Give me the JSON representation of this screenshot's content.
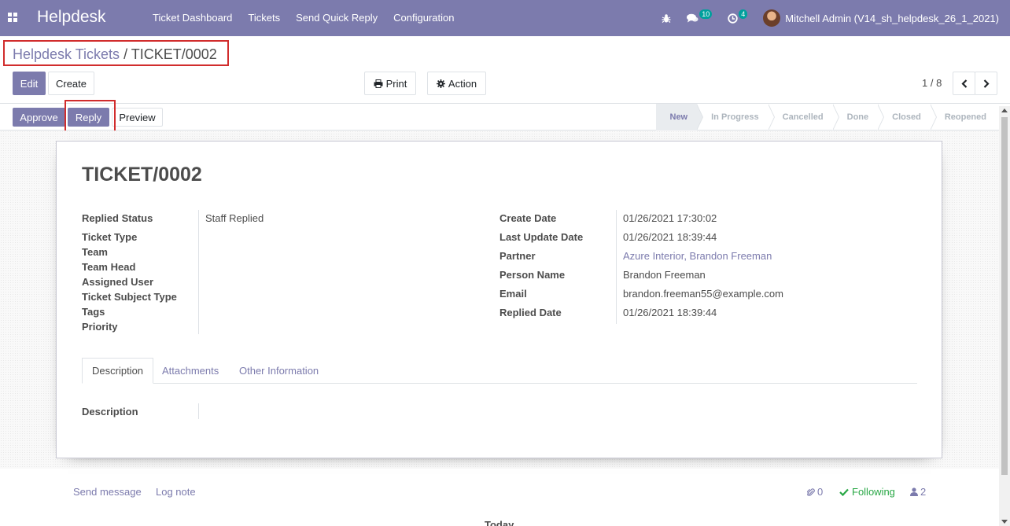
{
  "navbar": {
    "brand": "Helpdesk",
    "menu": [
      "Ticket Dashboard",
      "Tickets",
      "Send Quick Reply",
      "Configuration"
    ],
    "messages_count": "10",
    "activities_count": "4",
    "user": "Mitchell Admin (V14_sh_helpdesk_26_1_2021)",
    "color": "#7c7bad"
  },
  "breadcrumb": {
    "parent": "Helpdesk Tickets",
    "separator": " / ",
    "current": "TICKET/0002"
  },
  "toolbar": {
    "edit": "Edit",
    "create": "Create",
    "print": "Print",
    "action": "Action",
    "pager": "1 / 8"
  },
  "header_buttons": {
    "approve": "Approve",
    "reply": "Reply",
    "preview": "Preview"
  },
  "stages": [
    "New",
    "In Progress",
    "Cancelled",
    "Done",
    "Closed",
    "Reopened"
  ],
  "active_stage": "New",
  "ticket": {
    "title": "TICKET/0002",
    "left_fields": [
      {
        "label": "Replied Status",
        "value": "Staff Replied"
      },
      {
        "label": "Ticket Type",
        "value": ""
      },
      {
        "label": "Team",
        "value": ""
      },
      {
        "label": "Team Head",
        "value": ""
      },
      {
        "label": "Assigned User",
        "value": ""
      },
      {
        "label": "Ticket Subject Type",
        "value": ""
      },
      {
        "label": "Tags",
        "value": ""
      },
      {
        "label": "Priority",
        "value": ""
      }
    ],
    "right_fields": [
      {
        "label": "Create Date",
        "value": "01/26/2021 17:30:02"
      },
      {
        "label": "Last Update Date",
        "value": "01/26/2021 18:39:44"
      },
      {
        "label": "Partner",
        "value": "Azure Interior, Brandon Freeman"
      },
      {
        "label": "Person Name",
        "value": "Brandon Freeman"
      },
      {
        "label": "Email",
        "value": "brandon.freeman55@example.com"
      },
      {
        "label": "Replied Date",
        "value": "01/26/2021 18:39:44"
      }
    ],
    "tabs": [
      "Description",
      "Attachments",
      "Other Information"
    ],
    "description_label": "Description"
  },
  "chatter": {
    "send_message": "Send message",
    "log_note": "Log note",
    "attachments_count": "0",
    "following": "Following",
    "followers_count": "2",
    "today": "Today"
  }
}
